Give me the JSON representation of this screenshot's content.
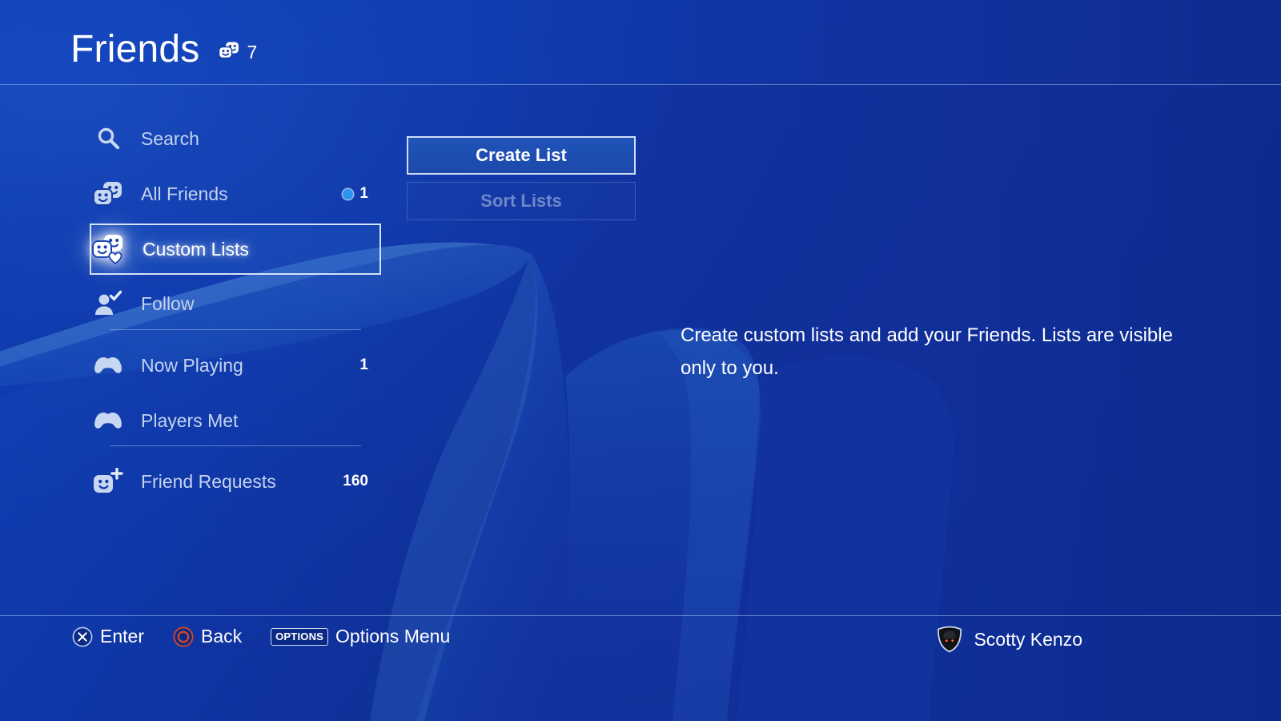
{
  "header": {
    "title": "Friends",
    "friends_icon": "friends-icon",
    "count": "7"
  },
  "sidebar": {
    "items": [
      {
        "label": "Search",
        "icon": "search-icon",
        "count": "",
        "online_dot": false,
        "selected": false
      },
      {
        "label": "All Friends",
        "icon": "friends-icon",
        "count": "1",
        "online_dot": true,
        "selected": false
      },
      {
        "label": "Custom Lists",
        "icon": "custom-lists-icon",
        "count": "",
        "online_dot": false,
        "selected": true
      },
      {
        "label": "Follow",
        "icon": "follow-icon",
        "count": "",
        "online_dot": false,
        "selected": false
      },
      {
        "label": "Now Playing",
        "icon": "controller-icon",
        "count": "1",
        "online_dot": false,
        "selected": false
      },
      {
        "label": "Players Met",
        "icon": "controller-icon",
        "count": "",
        "online_dot": false,
        "selected": false
      },
      {
        "label": "Friend Requests",
        "icon": "friend-request-icon",
        "count": "160",
        "online_dot": false,
        "selected": false
      }
    ]
  },
  "main": {
    "create_list_label": "Create List",
    "sort_lists_label": "Sort Lists",
    "description": "Create custom lists and add your Friends. Lists are visible only to you."
  },
  "footer": {
    "hints": [
      {
        "label": "Enter",
        "icon": "cross-button-icon"
      },
      {
        "label": "Back",
        "icon": "circle-button-icon"
      },
      {
        "label": "Options Menu",
        "icon": "options-button-icon",
        "badge": "OPTIONS"
      }
    ],
    "user": {
      "name": "Scotty Kenzo",
      "avatar": "avatar-icon"
    }
  },
  "colors": {
    "background_blue": "#0d34a8",
    "background_deep": "#102f96",
    "accent_white": "#ffffff",
    "online_dot": "#2e93ee",
    "selected_border": "#d5e2f6",
    "muted_text": "#c3d3ef",
    "disabled_text": "#8fa6cf",
    "circle_button_red": "#d8452a"
  }
}
